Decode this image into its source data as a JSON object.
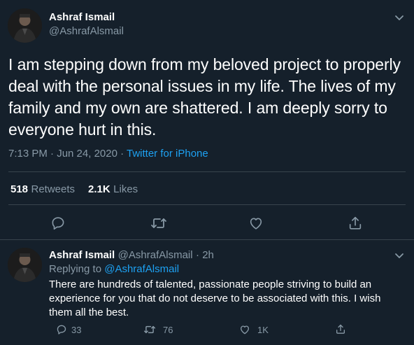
{
  "tweet": {
    "author_name": "Ashraf Ismail",
    "author_handle": "@AshrafAlsmail",
    "text": "I am stepping down from my beloved project to properly deal with the personal issues in my life. The lives of my family and my own are shattered. I am deeply sorry to everyone hurt in this.",
    "time": "7:13 PM · Jun 24, 2020 · ",
    "source": "Twitter for iPhone",
    "retweets_count": "518",
    "retweets_label": "Retweets",
    "likes_count": "2.1K",
    "likes_label": "Likes",
    "icons": [
      "reply-icon",
      "retweet-icon",
      "like-icon",
      "share-icon"
    ]
  },
  "reply": {
    "author_name": "Ashraf Ismail",
    "author_handle": "@AshrafAlsmail",
    "timestamp": "· 2h",
    "replying_prefix": "Replying to ",
    "replying_to": "@AshrafAlsmail",
    "text": "There are hundreds of talented, passionate people striving to build an experience for you that do not deserve to be associated with this. I wish them all the best.",
    "reply_count": "33",
    "retweet_count": "76",
    "like_count": "1K"
  },
  "colors": {
    "background": "#15202b",
    "text": "#ffffff",
    "secondary": "#8899a6",
    "accent": "#1da1f2",
    "divider": "#38444d"
  }
}
